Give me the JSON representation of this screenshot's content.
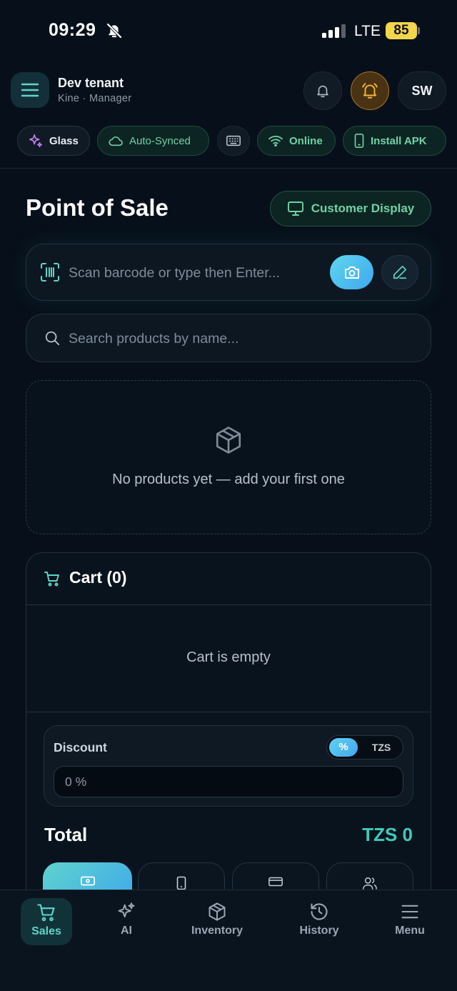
{
  "status_bar": {
    "time": "09:29",
    "network": "LTE",
    "battery": "85"
  },
  "header": {
    "tenant_name": "Dev tenant",
    "tenant_sub": "Kine · Manager",
    "avatar_initials": "SW"
  },
  "chips": {
    "glass": "Glass",
    "sync": "Auto-Synced",
    "online": "Online",
    "install": "Install APK"
  },
  "page": {
    "title": "Point of Sale",
    "customer_display": "Customer Display"
  },
  "scan": {
    "placeholder": "Scan barcode or type then Enter..."
  },
  "search": {
    "placeholder": "Search products by name..."
  },
  "products": {
    "empty_text": "No products yet — add your first one"
  },
  "cart": {
    "title": "Cart (0)",
    "empty_text": "Cart is empty",
    "discount_label": "Discount",
    "discount_mode_percent": "%",
    "discount_mode_currency": "TZS",
    "discount_placeholder": "0 %",
    "total_label": "Total",
    "total_value": "TZS 0"
  },
  "nav": {
    "sales": "Sales",
    "ai": "AI",
    "inventory": "Inventory",
    "history": "History",
    "menu": "Menu"
  },
  "colors": {
    "background": "#07101a",
    "accent_teal": "#3fcab8",
    "accent_blue": "#42a8ec",
    "warning": "#f2d64b"
  }
}
